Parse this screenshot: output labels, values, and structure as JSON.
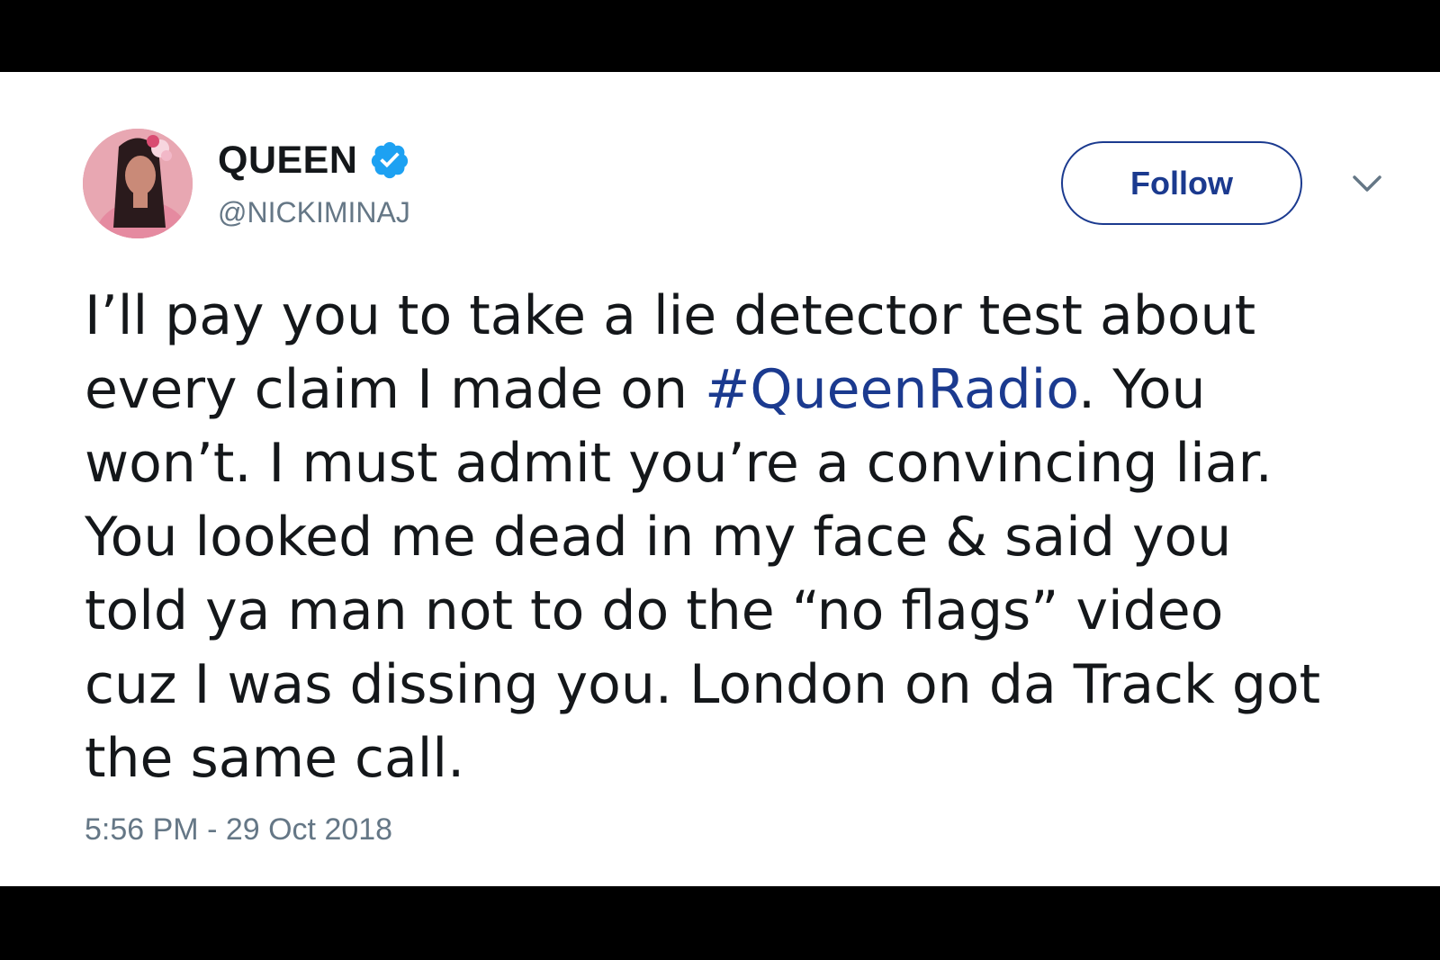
{
  "tweet": {
    "display_name": "QUEEN",
    "handle": "@NICKIMINAJ",
    "verified": true,
    "follow_label": "Follow",
    "text_lines": [
      "I’ll pay you to take a lie detector test about",
      "every claim I made on ",
      "won’t. I must admit you’re a convincing liar.",
      "You looked me dead in my face & said you",
      "told ya man not to do the “no flags” video",
      "cuz I was dissing you. London on da Track got",
      "the same call."
    ],
    "hashtag": "#QueenRadio",
    "hashtag_suffix": ". You",
    "timestamp": "5:56 PM - 29 Oct 2018"
  },
  "icons": {
    "verified": "verified-badge-icon",
    "caret": "chevron-down-icon",
    "avatar": "avatar"
  },
  "colors": {
    "link": "#1b3a8f",
    "verified": "#1da1f2",
    "text": "#14171a",
    "muted": "#657786",
    "letterbox": "#000000"
  }
}
